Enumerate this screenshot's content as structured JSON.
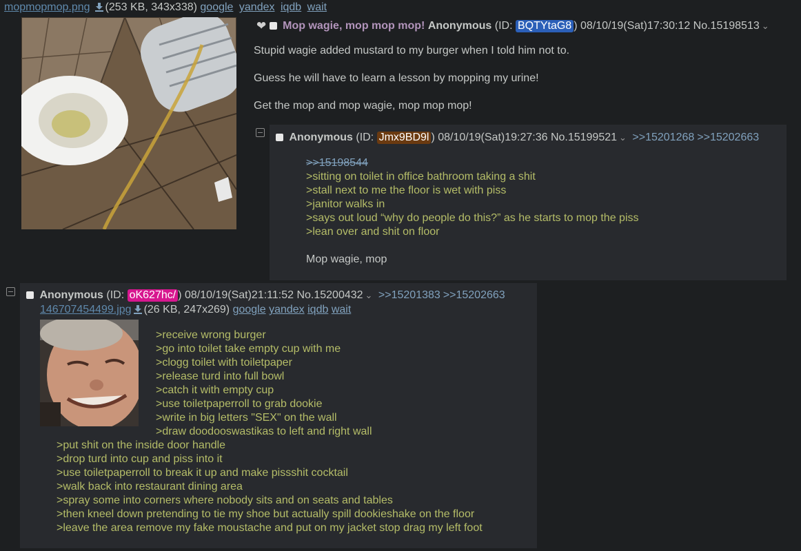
{
  "op": {
    "file": {
      "name": "mopmopmop.png",
      "info": "(253 KB, 343x338)",
      "search_links": [
        "google",
        "yandex",
        "iqdb",
        "wait"
      ]
    },
    "subject": "Mop wagie, mop mop mop!",
    "name": "Anonymous",
    "id_prefix": "(ID: ",
    "id": "BQTYtaG8",
    "id_color": "#2b5fb8",
    "datetime_suffix": ") 08/10/19(Sat)17:30:12 No.15198513",
    "body": [
      "Stupid wagie added mustard to my burger when I told him not to.",
      "Guess he will have to learn a lesson by mopping my urine!",
      "Get the mop and mop wagie, mop mop mop!"
    ]
  },
  "reply1": {
    "name": "Anonymous",
    "id_prefix": "(ID: ",
    "id": "Jmx9BD9l",
    "id_color": "#6b3a10",
    "datetime_suffix": ") 08/10/19(Sat)19:27:36 No.15199521",
    "backlinks": [
      ">>15201268",
      ">>15202663"
    ],
    "quote_link": ">>15198544",
    "greentext": [
      ">sitting on toilet in office bathroom taking a shit",
      ">stall next to me the floor is wet with piss",
      ">janitor walks in",
      ">says out loud “why do people do this?” as he starts to mop the piss",
      ">lean over and shit on floor"
    ],
    "closing": "Mop wagie, mop"
  },
  "reply2": {
    "name": "Anonymous",
    "id_prefix": "(ID: ",
    "id": "oK627hc/",
    "id_color": "#d7178f",
    "datetime_suffix": ") 08/10/19(Sat)21:11:52 No.15200432",
    "backlinks": [
      ">>15201383",
      ">>15202663"
    ],
    "file": {
      "name": "146707454499.jpg",
      "info": "(26 KB, 247x269)",
      "search_links": [
        "google",
        "yandex",
        "iqdb",
        "wait"
      ]
    },
    "greentext_beside": [
      ">receive wrong burger",
      ">go into toilet take empty cup with me",
      ">clogg toilet with toiletpaper",
      ">release turd into full bowl",
      ">catch it with empty cup",
      ">use toiletpaperroll to grab dookie",
      ">write in big letters \"SEX\" on the wall",
      ">draw doodooswastikas to left and right wall"
    ],
    "greentext_below": [
      ">put shit on the inside door handle",
      ">drop turd into cup and piss into it",
      ">use toiletpaperroll to break it up and make pissshit cocktail",
      ">walk back into restaurant dining area",
      ">spray some into corners where nobody sits and on seats and tables",
      ">then kneel down pretending to tie my shoe but actually spill dookieshake on the floor",
      ">leave the area remove my fake moustache and put on my jacket stop drag my left foot"
    ]
  }
}
